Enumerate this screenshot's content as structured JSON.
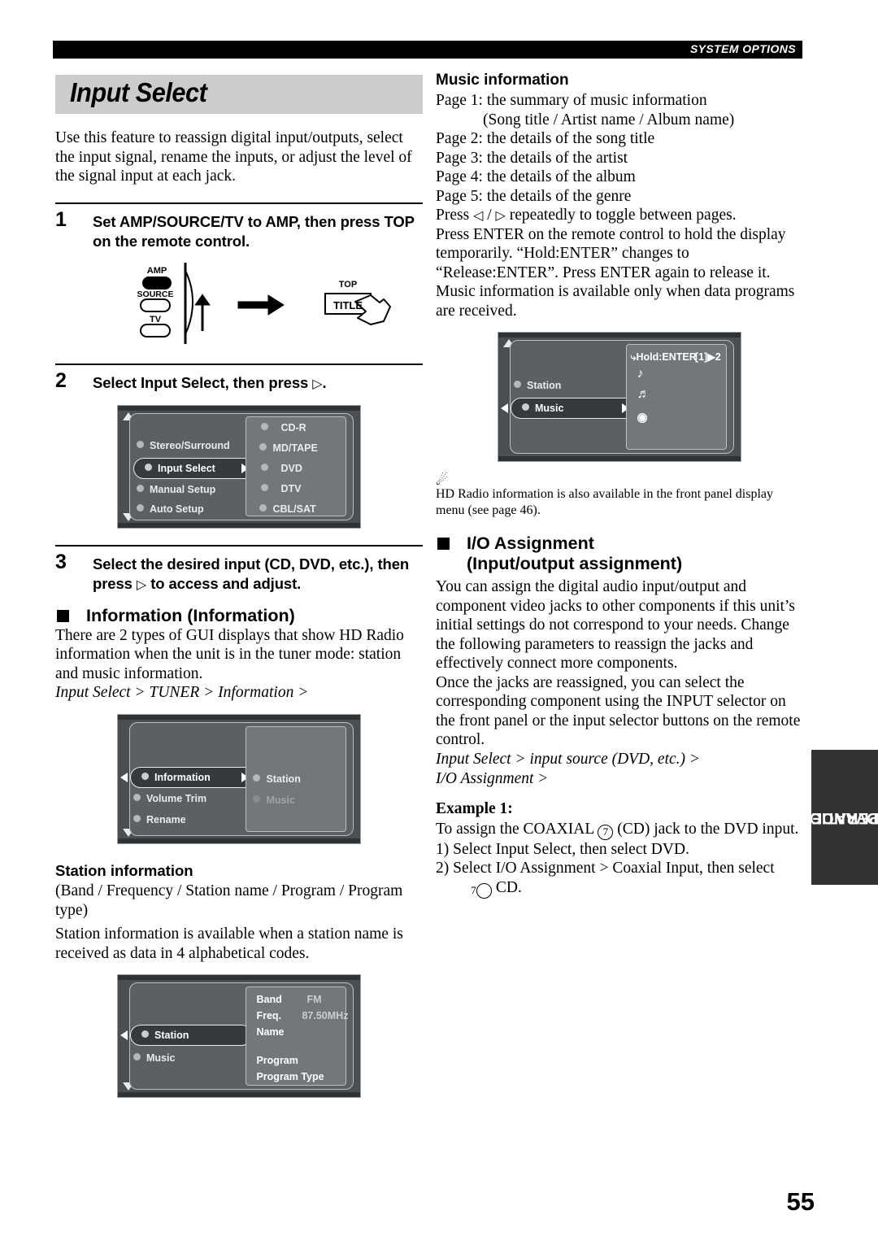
{
  "header": {
    "running_head": "SYSTEM OPTIONS"
  },
  "page_number": "55",
  "side_tab": {
    "label": "ADVANCED\nOPERATION",
    "line1": "ADVANCED",
    "line2": "OPERATION"
  },
  "left": {
    "title": "Input Select",
    "intro": "Use this feature to reassign digital input/outputs, select the input signal, rename the inputs, or adjust the level of the signal input at each jack.",
    "step1": {
      "num": "1",
      "text": "Set AMP/SOURCE/TV to AMP, then press TOP on the remote control."
    },
    "remote_diagram": {
      "amp_label": "AMP",
      "source_label": "SOURCE",
      "tv_label": "TV",
      "top_label": "TOP",
      "title_label": "TITLE"
    },
    "step2": {
      "num": "2",
      "text_before": "Select Input Select, then press",
      "glyph": "▷",
      "text_after": "."
    },
    "menu1": {
      "left_items": [
        "Stereo/Surround",
        "Input Select",
        "Manual Setup",
        "Auto Setup"
      ],
      "selected_left": "Input Select",
      "right_items": [
        "CD-R",
        "MD/TAPE",
        "DVD",
        "DTV",
        "CBL/SAT"
      ]
    },
    "step3": {
      "num": "3",
      "text_before": "Select the desired input (CD, DVD, etc.), then press",
      "glyph": "▷",
      "text_after": "to access and adjust."
    },
    "information_head": "Information (Information)",
    "information_body": "There are 2 types of GUI displays that show HD Radio information when the unit is in the tuner mode: station and music information.",
    "information_path": "Input Select > TUNER > Information >",
    "menu2": {
      "left_items": [
        "Information",
        "Volume Trim",
        "Rename"
      ],
      "selected_left": "Information",
      "right_items": [
        "Station",
        "Music"
      ],
      "right_enabled": "Station",
      "right_dimmed": "Music"
    },
    "station_head": "Station information",
    "station_body1": "(Band / Frequency / Station name / Program / Program type)",
    "station_body2": "Station information is available when a station name is received as data in 4 alphabetical codes.",
    "menu3": {
      "left_items": [
        "Station",
        "Music"
      ],
      "selected_left": "Station",
      "fields": [
        {
          "label": "Band",
          "value": "FM"
        },
        {
          "label": "Freq.",
          "value": "87.50MHz"
        },
        {
          "label": "Name",
          "value": ""
        },
        {
          "label": "Program",
          "value": ""
        },
        {
          "label": "Program Type",
          "value": ""
        }
      ]
    }
  },
  "right": {
    "music_head": "Music information",
    "music_pages": [
      "Page 1: the summary of music information",
      "(Song title / Artist name / Album name)",
      "Page 2: the details of the song title",
      "Page 3: the details of the artist",
      "Page 4: the details of the album",
      "Page 5: the details of the genre"
    ],
    "music_note1_before": "Press",
    "music_note1_glyph_left": "◁",
    "music_note1_sep": "/",
    "music_note1_glyph_right": "▷",
    "music_note1_after": "repeatedly to toggle between pages.",
    "music_note2": "Press ENTER on the remote control to hold the display temporarily. “Hold:ENTER” changes to “Release:ENTER”. Press ENTER again to release it. Music information is available only when data programs are received.",
    "menu4": {
      "left_items": [
        "Station",
        "Music"
      ],
      "selected_left": "Music",
      "hold_label": "Hold:ENTER",
      "page_indicator": "[1]▶2",
      "icons": [
        "music-note",
        "artist-note",
        "album-disc"
      ]
    },
    "tip_icon": "tip-bulb-icon",
    "tip_text": "HD Radio information is also available in the front panel display menu (see page 46).",
    "io_head_line1": "I/O Assignment",
    "io_head_line2": "(Input/output assignment)",
    "io_body1": "You can assign the digital audio input/output and component video jacks to other components if this unit’s initial settings do not correspond to your needs. Change the following parameters to reassign the jacks and effectively connect more components.",
    "io_body2": "Once the jacks are reassigned, you can select the corresponding component using the INPUT selector on the front panel or the input selector buttons on the remote control.",
    "io_path1": "Input Select > input source (DVD, etc.) >",
    "io_path2": "I/O Assignment >",
    "example_head": "Example 1:",
    "example_line1_a": "To assign the COAXIAL",
    "example_line1_circled": "7",
    "example_line1_b": "(CD) jack to the DVD input.",
    "example_step1": "1) Select Input Select, then select DVD.",
    "example_step2_a": "2) Select I/O Assignment > Coaxial Input, then select",
    "example_step2_circled": "7",
    "example_step2_b": "CD."
  }
}
